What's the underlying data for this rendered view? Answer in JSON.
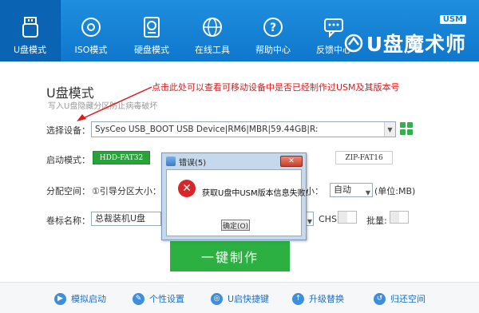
{
  "nav": {
    "items": [
      {
        "label": "U盘模式",
        "icon": "usb-drive-icon"
      },
      {
        "label": "ISO模式",
        "icon": "disc-icon"
      },
      {
        "label": "硬盘模式",
        "icon": "hard-disk-icon"
      },
      {
        "label": "在线工具",
        "icon": "globe-icon"
      },
      {
        "label": "帮助中心",
        "icon": "help-icon"
      },
      {
        "label": "反馈中心",
        "icon": "feedback-icon"
      }
    ],
    "brand": "U盘魔术师",
    "brand_badge": "USM"
  },
  "page": {
    "title": "U盘模式",
    "subtitle": "写入U盘隐藏分区防止病毒破坏",
    "annotation": "点击此处可以查看可移动设备中是否已经制作过USM及其版本号"
  },
  "form": {
    "device_label": "选择设备：",
    "device_value": "SysCeo USB_BOOT USB Device|RM6|MBR|59.44GB|R:",
    "boot_label": "启动模式：",
    "boot_modes": [
      "HDD-FAT32",
      "ZIP-FAT16"
    ],
    "partition_label": "分配空间：",
    "partition_text": "①引导分区大小：",
    "partition_suffix": "小：",
    "partition_value": "自动",
    "partition_unit": "(单位:MB)",
    "volume_label": "卷标名称：",
    "volume_value": "总裁装机U盘",
    "chs_label": "CHS:",
    "batch_label": "批量:",
    "main_button": "一键制作"
  },
  "footer": {
    "items": [
      {
        "label": "模拟启动",
        "icon": "simulate-icon"
      },
      {
        "label": "个性设置",
        "icon": "settings-icon"
      },
      {
        "label": "U启快捷键",
        "icon": "shortcut-icon"
      },
      {
        "label": "升级替换",
        "icon": "upgrade-icon"
      },
      {
        "label": "归还空间",
        "icon": "restore-icon"
      }
    ]
  },
  "dialog": {
    "title": "错误(5)",
    "message": "获取U盘中USM版本信息失败!",
    "ok_label": "确定(O)",
    "close_label": "✕"
  },
  "colors": {
    "header": "#1382d6",
    "active_tab": "#0a64b3",
    "green": "#2bb041",
    "annotation": "#e0191b"
  }
}
